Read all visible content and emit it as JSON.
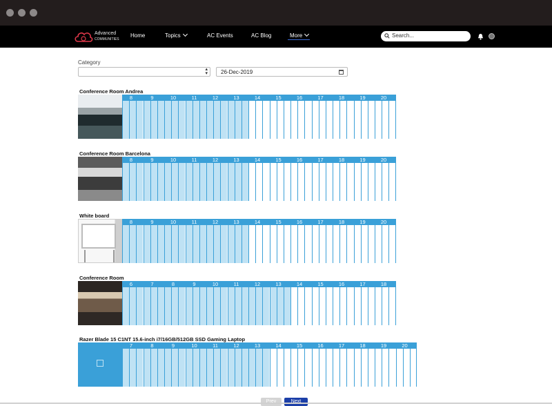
{
  "brand": {
    "line1": "Advanced",
    "line2": "COMMUNITIES"
  },
  "nav": {
    "home": "Home",
    "topics": "Topics",
    "events": "AC Events",
    "blog": "AC Blog",
    "more": "More"
  },
  "search": {
    "placeholder": "Search..."
  },
  "filters": {
    "category_label": "Category",
    "category_value": "",
    "date_value": "26-Dec-2019"
  },
  "resources": [
    {
      "name": "Conference Room Andrea",
      "hours": [
        "8",
        "9",
        "10",
        "11",
        "12",
        "13",
        "14",
        "15",
        "16",
        "17",
        "18",
        "19",
        "20"
      ],
      "booked_hours": 6
    },
    {
      "name": "Conference Room Barcelona",
      "hours": [
        "8",
        "9",
        "10",
        "11",
        "12",
        "13",
        "14",
        "15",
        "16",
        "17",
        "18",
        "19",
        "20"
      ],
      "booked_hours": 6
    },
    {
      "name": "White board",
      "hours": [
        "8",
        "9",
        "10",
        "11",
        "12",
        "13",
        "14",
        "15",
        "16",
        "17",
        "18",
        "19",
        "20"
      ],
      "booked_hours": 6
    },
    {
      "name": "Conference Room",
      "hours": [
        "6",
        "7",
        "8",
        "9",
        "10",
        "11",
        "12",
        "13",
        "14",
        "15",
        "16",
        "17",
        "18"
      ],
      "booked_hours": 8
    },
    {
      "name": "Razer Blade 15 C1NT 15.6-inch i7/16GB/512GB SSD Gaming Laptop",
      "hours": [
        "7",
        "8",
        "9",
        "10",
        "11",
        "12",
        "13",
        "14",
        "15",
        "16",
        "17",
        "18",
        "19",
        "20"
      ],
      "booked_hours": 7
    }
  ],
  "pagination": {
    "prev": "Prev",
    "next": "Next"
  },
  "colors": {
    "accent": "#3aa0d8",
    "booked": "#bfe2f4",
    "nav_bg": "#000000",
    "next_btn": "#1c3fa8"
  }
}
